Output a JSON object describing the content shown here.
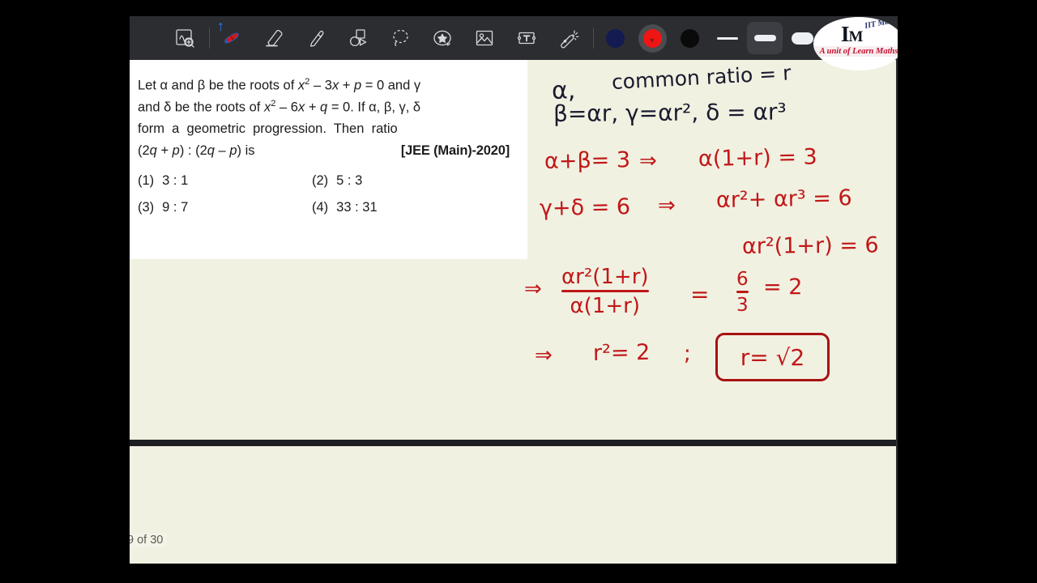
{
  "app": {
    "logo": {
      "brand_top": "IIT Maths",
      "monogram": "IM",
      "tagline": "A unit of Learn Maths"
    }
  },
  "toolbar": {
    "tools": [
      {
        "name": "select-zoom-tool",
        "icon": "select-zoom-icon",
        "label": "Select / Zoom",
        "active": false
      },
      {
        "name": "pen-tool",
        "icon": "pen-icon",
        "label": "Pen",
        "active": true
      },
      {
        "name": "eraser-tool",
        "icon": "eraser-icon",
        "label": "Eraser",
        "active": false
      },
      {
        "name": "highlighter-tool",
        "icon": "highlighter-icon",
        "label": "Highlighter",
        "active": false
      },
      {
        "name": "shapes-tool",
        "icon": "shapes-icon",
        "label": "Shapes",
        "active": false
      },
      {
        "name": "lasso-tool",
        "icon": "lasso-icon",
        "label": "Lasso Select",
        "active": false
      },
      {
        "name": "sticker-tool",
        "icon": "sticker-star-icon",
        "label": "Sticker",
        "active": false
      },
      {
        "name": "image-tool",
        "icon": "image-icon",
        "label": "Insert Image",
        "active": false
      },
      {
        "name": "text-tool",
        "icon": "text-box-icon",
        "label": "Text Box",
        "active": false
      },
      {
        "name": "magic-wand-tool",
        "icon": "magic-wand-icon",
        "label": "Magic Wand",
        "active": false
      }
    ],
    "bluetooth_indicator": "bluetooth-icon",
    "colors": [
      {
        "name": "color-navy",
        "hex": "#141a52",
        "selected": false
      },
      {
        "name": "color-red",
        "hex": "#f01515",
        "selected": true
      },
      {
        "name": "color-black",
        "hex": "#0a0a0a",
        "selected": false
      }
    ],
    "stroke_widths": [
      {
        "name": "stroke-thin",
        "label": "Thin",
        "selected": false
      },
      {
        "name": "stroke-medium",
        "label": "Medium",
        "selected": true
      },
      {
        "name": "stroke-thick",
        "label": "Thick",
        "selected": false
      }
    ]
  },
  "question": {
    "line1_a": "Let ",
    "line1_alpha": "α",
    "line1_b": " and ",
    "line1_beta": "β",
    "line1_c": " be the roots of ",
    "line1_eq1": "x",
    "line1_eq1_sup": "2",
    "line1_eq1_rest": " – 3x + p = 0 and ",
    "line1_gamma": "γ",
    "line2": "and δ be the roots of x² – 6x + q = 0. If α, β, γ, δ",
    "line3": "form  a  geometric  progression.  Then  ratio",
    "line4": "(2q + p) : (2q – p) is",
    "exam_tag": "[JEE (Main)-2020]",
    "options": [
      {
        "num": "(1)",
        "value": "3 : 1"
      },
      {
        "num": "(2)",
        "value": "5 : 3"
      },
      {
        "num": "(3)",
        "value": "9 : 7"
      },
      {
        "num": "(4)",
        "value": "33 : 31"
      }
    ]
  },
  "viewer": {
    "page_counter": "9 of 30"
  },
  "annotations": {
    "ink_color": "#c01818",
    "ink_color_dark": "#1a1a2e",
    "lines": [
      {
        "id": "alpha-label",
        "text": "α,"
      },
      {
        "id": "common-ratio",
        "text": "common ratio = r"
      },
      {
        "id": "gp-terms",
        "text": "β=αr, γ=αr², δ = αr³"
      },
      {
        "id": "sum-ab",
        "text": "α+β= 3"
      },
      {
        "id": "implies-1",
        "text": "⇒"
      },
      {
        "id": "sum-ab-expanded",
        "text": "α(1+r) = 3"
      },
      {
        "id": "sum-gd",
        "text": "γ+δ = 6"
      },
      {
        "id": "implies-2",
        "text": "⇒"
      },
      {
        "id": "sum-gd-expanded",
        "text": "αr²+ αr³ = 6"
      },
      {
        "id": "sum-gd-factored",
        "text": "αr²(1+r) =  6"
      },
      {
        "id": "implies-3",
        "text": "⇒"
      },
      {
        "id": "ratio-numerator",
        "text": "αr²(1+r)"
      },
      {
        "id": "ratio-denominator",
        "text": "α(1+r)"
      },
      {
        "id": "equals-1",
        "text": "="
      },
      {
        "id": "frac-numerator",
        "text": "6"
      },
      {
        "id": "frac-denominator",
        "text": "3"
      },
      {
        "id": "equals-two",
        "text": "= 2"
      },
      {
        "id": "implies-4",
        "text": "⇒"
      },
      {
        "id": "r-squared",
        "text": "r²= 2"
      },
      {
        "id": "semicolon",
        "text": ";"
      },
      {
        "id": "boxed-answer",
        "text": "r= √2"
      }
    ]
  }
}
